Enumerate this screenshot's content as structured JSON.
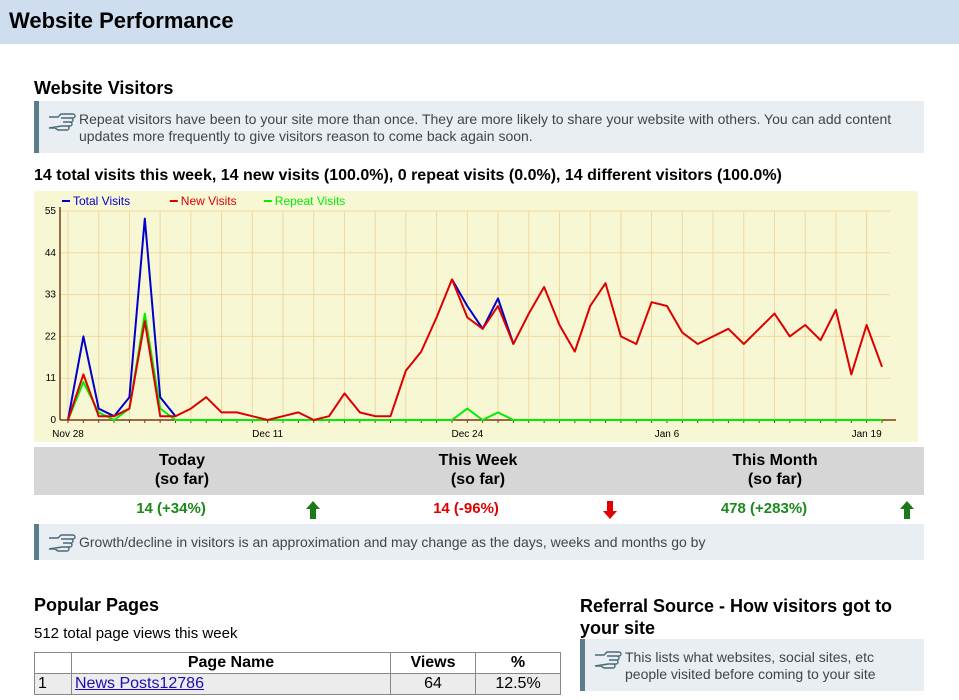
{
  "page_title": "Website Performance",
  "visitors_section": {
    "heading": "Website Visitors",
    "tip": "Repeat visitors have been to your site more than once. They are more likely to share your website with others. You can add content updates more frequently to give visitors reason to come back again soon.",
    "summary": "14 total visits this week, 14 new visits (100.0%), 0 repeat visits (0.0%), 14 different visitors (100.0%)"
  },
  "chart_data": {
    "type": "line",
    "x_tick_labels": [
      "Nov 28",
      "Dec 11",
      "Dec 24",
      "Jan 6",
      "Jan 19"
    ],
    "y_ticks": [
      0,
      11,
      22,
      33,
      44,
      55
    ],
    "ylim": [
      0,
      55
    ],
    "grid": true,
    "legend_placement": "top-left",
    "series": [
      {
        "name": "Total Visits",
        "color": "#0000cc",
        "values": [
          0,
          22,
          3,
          1,
          6,
          53,
          6,
          1,
          null,
          null,
          null,
          null,
          null,
          null,
          null,
          null,
          null,
          null,
          null,
          null,
          null,
          null,
          null,
          null,
          null,
          37,
          30,
          24,
          32,
          20
        ]
      },
      {
        "name": "New Visits",
        "color": "#dd0000",
        "values": [
          0,
          12,
          1,
          1,
          3,
          26,
          1,
          1,
          3,
          6,
          2,
          2,
          1,
          0,
          1,
          2,
          0,
          1,
          7,
          2,
          1,
          1,
          13,
          18,
          27,
          37,
          27,
          24,
          30,
          20,
          28,
          35,
          25,
          18,
          30,
          36,
          22,
          20,
          31,
          30,
          23,
          20,
          22,
          24,
          20,
          24,
          28,
          22,
          25,
          21,
          29,
          12,
          25,
          14
        ]
      },
      {
        "name": "Repeat Visits",
        "color": "#00ee00",
        "values": [
          0,
          10,
          2,
          0,
          3,
          28,
          3,
          0,
          0,
          0,
          0,
          0,
          0,
          0,
          0,
          0,
          0,
          0,
          0,
          0,
          0,
          0,
          0,
          0,
          0,
          0,
          3,
          0,
          2,
          0,
          0,
          0,
          0,
          0,
          0,
          0,
          0,
          0,
          0,
          0,
          0,
          0,
          0,
          0,
          0,
          0,
          0,
          0,
          0,
          0,
          0,
          0,
          0,
          0
        ]
      }
    ]
  },
  "stats": {
    "today": {
      "label": "Today",
      "sub": "(so far)",
      "value": "14 (+34%)",
      "trend": "up",
      "color": "#1a8a1a"
    },
    "week": {
      "label": "This Week",
      "sub": "(so far)",
      "value": "14 (-96%)",
      "trend": "down",
      "color": "#e00000"
    },
    "month": {
      "label": "This Month",
      "sub": "(so far)",
      "value": "478 (+283%)",
      "trend": "up",
      "color": "#1a8a1a"
    }
  },
  "growth_tip": "Growth/decline in visitors is an approximation and may change as the days, weeks and months go by",
  "popular": {
    "heading": "Popular Pages",
    "subtitle": "512 total page views this week",
    "columns": [
      "",
      "Page Name",
      "Views",
      "%"
    ],
    "rows": [
      {
        "rank": "1",
        "name": "News Posts12786",
        "views": "64",
        "pct": "12.5%"
      }
    ]
  },
  "referral": {
    "heading": "Referral Source - How visitors got to your site",
    "tip": "This lists what websites, social sites, etc people visited before coming to your site"
  }
}
